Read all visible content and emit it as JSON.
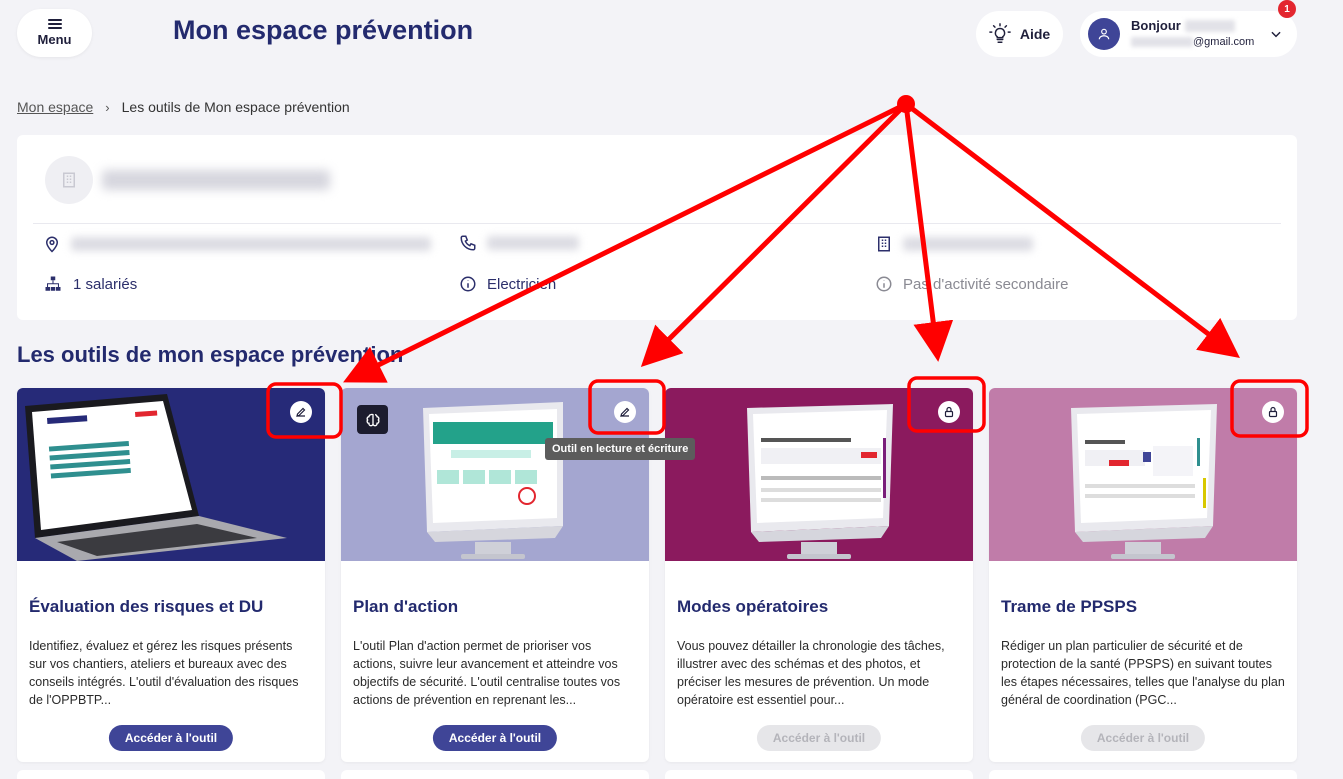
{
  "header": {
    "menu_label": "Menu",
    "title": "Mon espace prévention",
    "help_label": "Aide",
    "greeting": "Bonjour",
    "email_suffix": "@gmail.com",
    "notification_count": "1"
  },
  "breadcrumb": {
    "home": "Mon espace",
    "separator": "›",
    "current": "Les outils de Mon espace prévention"
  },
  "company": {
    "employees": "1 salariés",
    "activity": "Electricien",
    "secondary_activity": "Pas d'activité secondaire"
  },
  "section_title": "Les outils de mon espace prévention",
  "tools": [
    {
      "title": "Évaluation des risques et DU",
      "description": "Identifiez, évaluez et gérez les risques présents sur vos chantiers, ateliers et bureaux avec des conseils intégrés. L'outil d'évaluation des risques de l'OPPBTP...",
      "button": "Accéder à l'outil",
      "status_icon": "pencil-icon",
      "enabled": true
    },
    {
      "title": "Plan d'action",
      "description": "L'outil Plan d'action permet de prioriser vos actions, suivre leur avancement et atteindre vos objectifs de sécurité. L'outil centralise toutes vos actions de prévention en reprenant les...",
      "button": "Accéder à l'outil",
      "status_icon": "pencil-icon",
      "enabled": true
    },
    {
      "title": "Modes opératoires",
      "description": "Vous pouvez détailler la chronologie des tâches, illustrer avec des schémas et des photos, et préciser les mesures de prévention. Un mode opératoire est essentiel pour...",
      "button": "Accéder à l'outil",
      "status_icon": "lock-icon",
      "enabled": false
    },
    {
      "title": "Trame de PPSPS",
      "description": "Rédiger un plan particulier de sécurité et de protection de la santé (PPSPS) en suivant toutes les étapes nécessaires, telles que l'analyse du plan général de coordination (PGC...",
      "button": "Accéder à l'outil",
      "status_icon": "lock-icon",
      "enabled": false
    }
  ],
  "tooltip": "Outil en lecture et écriture",
  "colors": {
    "primary": "#3f4597",
    "title": "#232a6e",
    "card1_bg": "#262a78",
    "card2_bg": "#a4a6d0",
    "card3_bg": "#8b1a5e",
    "card4_bg": "#c07ca9",
    "annotation": "#ff0000"
  }
}
